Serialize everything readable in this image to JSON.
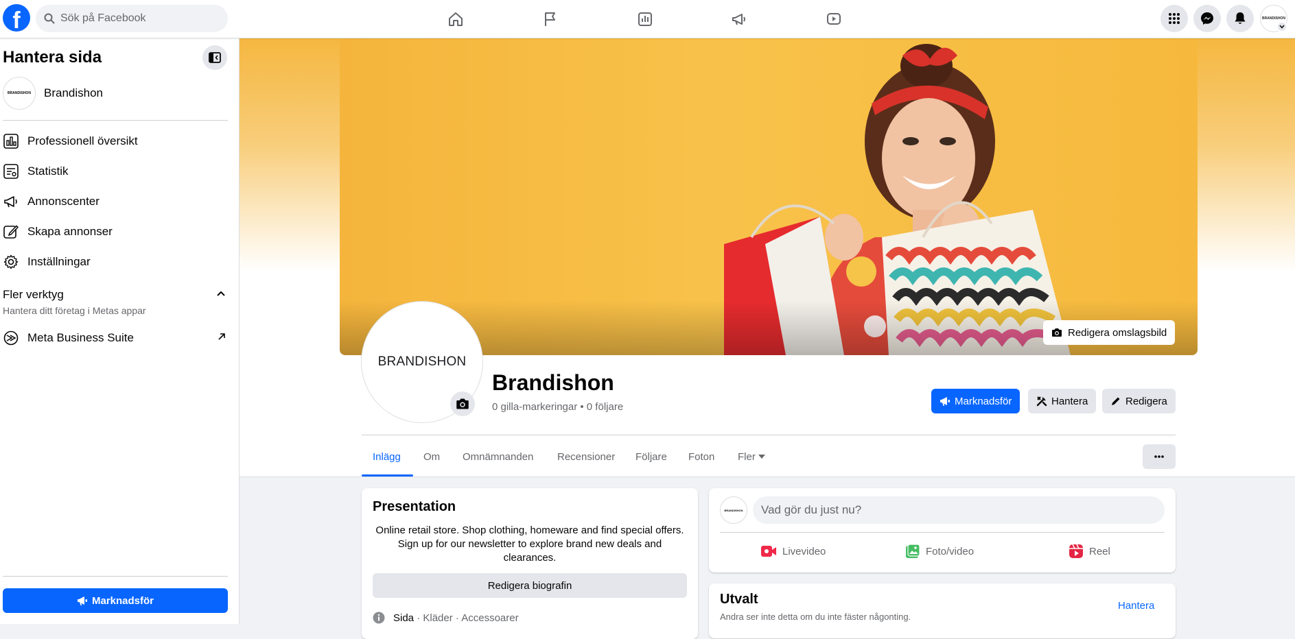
{
  "topbar": {
    "search_placeholder": "Sök på Facebook",
    "nav_icons": [
      "home-icon",
      "flag-icon",
      "insights-icon",
      "megaphone-icon",
      "video-icon"
    ],
    "right_icons": [
      "menu-grid-icon",
      "messenger-icon",
      "bell-icon"
    ],
    "avatar_text": "BRANDISHON"
  },
  "sidebar": {
    "title": "Hantera sida",
    "page_name": "Brandishon",
    "page_avatar_text": "BRANDISHON",
    "items": [
      {
        "label": "Professionell översikt",
        "icon": "dashboard-icon"
      },
      {
        "label": "Statistik",
        "icon": "stats-icon"
      },
      {
        "label": "Annonscenter",
        "icon": "megaphone-icon"
      },
      {
        "label": "Skapa annonser",
        "icon": "pencil-icon"
      },
      {
        "label": "Inställningar",
        "icon": "gear-icon"
      }
    ],
    "more_tools_title": "Fler verktyg",
    "more_tools_subtitle": "Hantera ditt företag i Metas appar",
    "meta_suite": "Meta Business Suite",
    "promote_label": "Marknadsför"
  },
  "header": {
    "edit_cover_label": "Redigera omslagsbild",
    "profile_text": "BRANDISHON",
    "page_name": "Brandishon",
    "stats": "0 gilla-markeringar • 0 följare",
    "promote_label": "Marknadsför",
    "manage_label": "Hantera",
    "edit_label": "Redigera"
  },
  "tabs": [
    "Inlägg",
    "Om",
    "Omnämnanden",
    "Recensioner",
    "Följare",
    "Foton",
    "Fler"
  ],
  "presentation": {
    "title": "Presentation",
    "bio": "Online retail store. Shop clothing, homeware and find special offers. Sign up for our newsletter to explore brand new deals and clearances.",
    "edit_bio_label": "Redigera biografin",
    "info_type": "Sida",
    "info_categories": " · Kläder · Accessoarer"
  },
  "composer": {
    "avatar_text": "BRANDISHON",
    "placeholder": "Vad gör du just nu?",
    "actions": [
      "Livevideo",
      "Foto/video",
      "Reel"
    ]
  },
  "featured": {
    "title": "Utvalt",
    "subtitle": "Andra ser inte detta om du inte fäster någonting.",
    "manage_label": "Hantera"
  },
  "colors": {
    "accent": "#0866ff",
    "cover": "#f6b93d",
    "live": "#f02849",
    "photo": "#45bd62",
    "reel": "#e42645"
  }
}
